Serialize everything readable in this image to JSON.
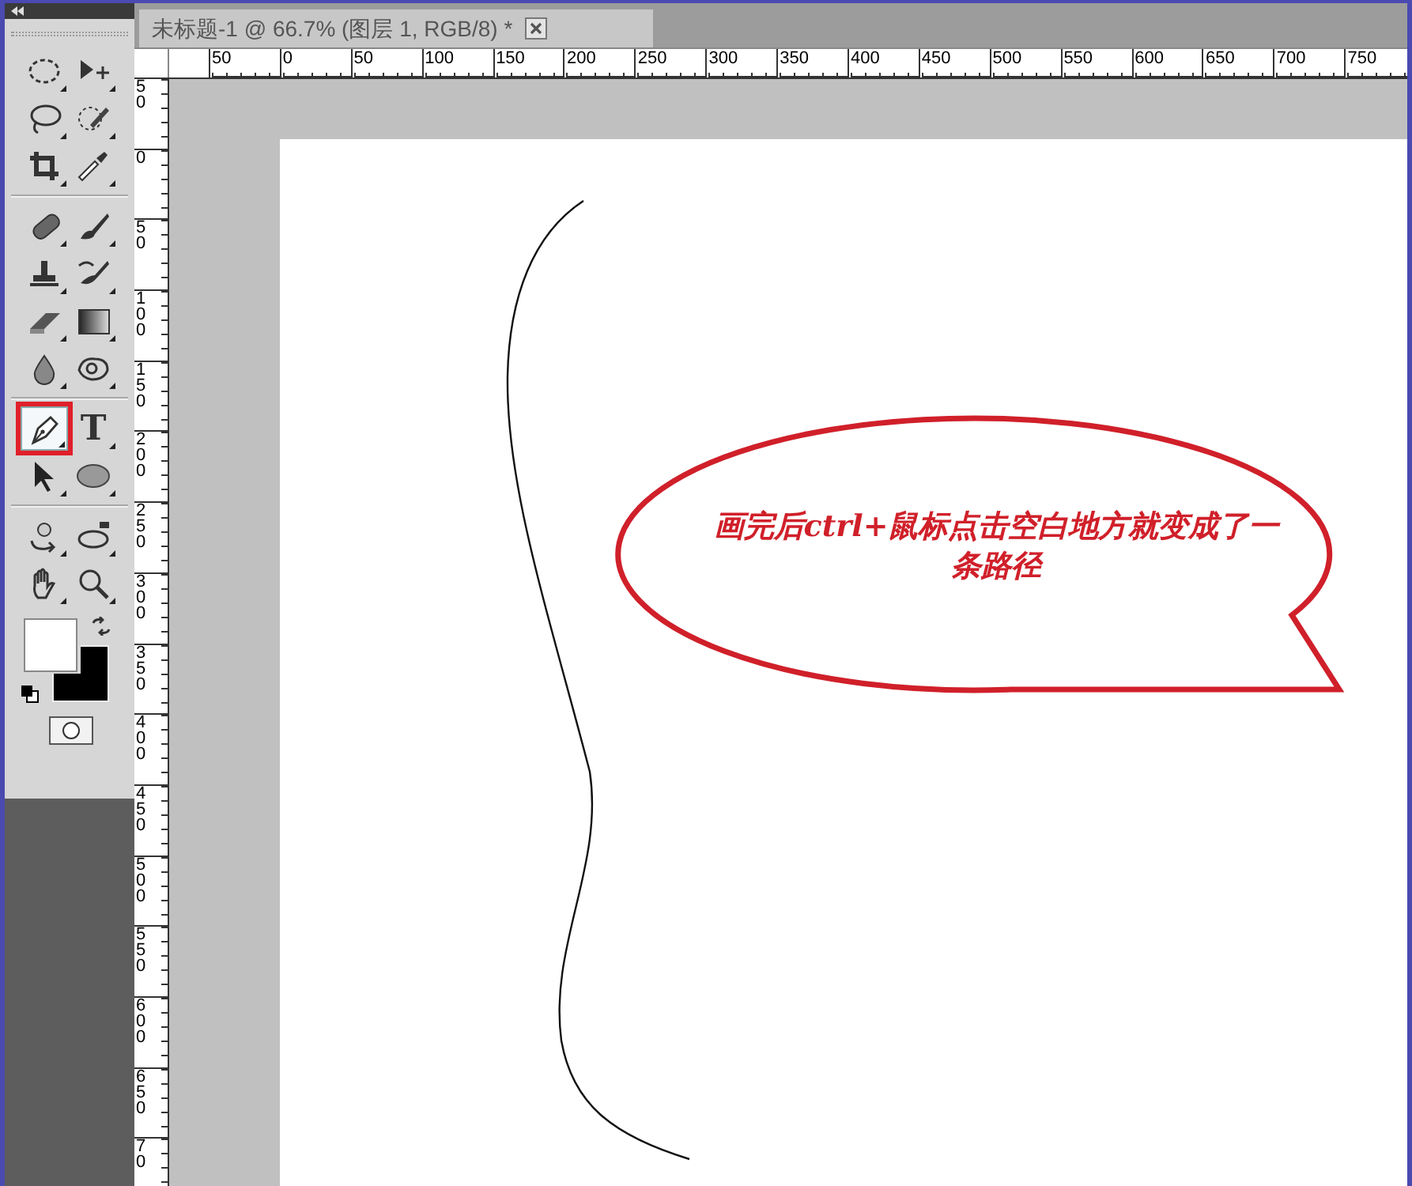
{
  "document_tab": {
    "title": "未标题-1 @ 66.7% (图层 1, RGB/8) *"
  },
  "tool_groups": [
    {
      "tools": [
        {
          "kind": "marquee",
          "selected": false
        },
        {
          "kind": "move",
          "selected": false
        },
        {
          "kind": "lasso",
          "selected": false
        },
        {
          "kind": "quick-select",
          "selected": false
        },
        {
          "kind": "crop",
          "selected": false
        },
        {
          "kind": "eyedropper",
          "selected": false
        }
      ]
    },
    {
      "tools": [
        {
          "kind": "healing",
          "selected": false
        },
        {
          "kind": "brush",
          "selected": false
        },
        {
          "kind": "stamp",
          "selected": false
        },
        {
          "kind": "history-brush",
          "selected": false
        },
        {
          "kind": "eraser",
          "selected": false
        },
        {
          "kind": "gradient",
          "selected": false
        },
        {
          "kind": "blur",
          "selected": false
        },
        {
          "kind": "dodge",
          "selected": false
        }
      ]
    },
    {
      "tools": [
        {
          "kind": "pen",
          "selected": true
        },
        {
          "kind": "type",
          "glyph": "T",
          "selected": false
        },
        {
          "kind": "path-select",
          "selected": false
        },
        {
          "kind": "shape",
          "selected": false
        }
      ]
    },
    {
      "tools": [
        {
          "kind": "rotate-3d",
          "selected": false
        },
        {
          "kind": "orbit-3d",
          "selected": false
        },
        {
          "kind": "hand",
          "selected": false
        },
        {
          "kind": "zoom",
          "selected": false
        }
      ]
    }
  ],
  "color_swatches": [
    {
      "kind": "foreground",
      "color": "#ffffff"
    },
    {
      "kind": "background",
      "color": "#000000"
    }
  ],
  "horizontal_ruler": [
    "50",
    "0",
    "50",
    "100",
    "150",
    "200",
    "250",
    "300",
    "350",
    "400",
    "450",
    "500",
    "550",
    "600",
    "650",
    "700",
    "750"
  ],
  "vertical_ruler": [
    "50",
    "0",
    "50",
    "100",
    "150",
    "200",
    "250",
    "300",
    "350",
    "400",
    "450",
    "500",
    "550",
    "600",
    "650",
    "70"
  ],
  "callout": {
    "text_lines": [
      "画完后ctrl+鼠标点击空白地方就变成了一",
      "条路径"
    ],
    "color": "#d0202a"
  }
}
